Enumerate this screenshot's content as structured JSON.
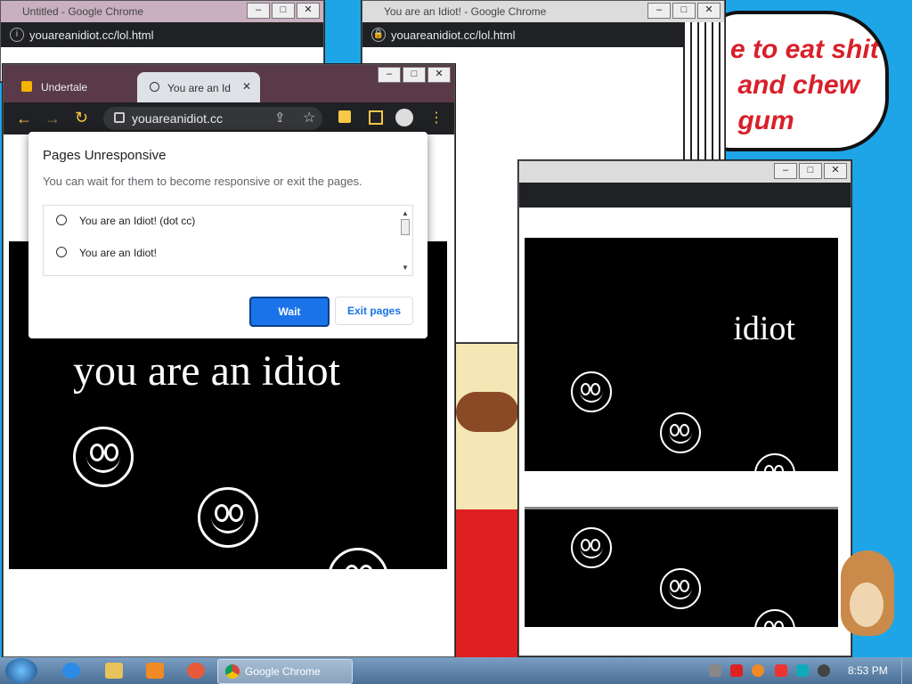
{
  "wallpaper": {
    "bubble_text": "e to eat shit\n and chew\n gum"
  },
  "win_back_left": {
    "title": "Untitled - Google Chrome",
    "url": "youareanidiot.cc/lol.html"
  },
  "win_back_right": {
    "title": "You are an Idiot! - Google Chrome",
    "url": "youareanidiot.cc/lol.html"
  },
  "win_main": {
    "tab_inactive": "Undertale",
    "tab_active": "You are an Id",
    "url": "youareanidiot.cc",
    "heading": "you are an idiot"
  },
  "win_right_lower": {
    "heading": "idiot"
  },
  "dialog": {
    "title": "Pages Unresponsive",
    "message": "You can wait for them to become responsive or exit the pages.",
    "items": [
      "You are an Idiot! (dot cc)",
      "You are an Idiot!"
    ],
    "wait_label": "Wait",
    "exit_label": "Exit pages"
  },
  "taskbar": {
    "chrome_label": "Google Chrome",
    "clock": "8:53 PM"
  },
  "colors": {
    "accent": "#1a73e8",
    "desktop": "#1ea5e8",
    "page_bg": "#000000"
  }
}
